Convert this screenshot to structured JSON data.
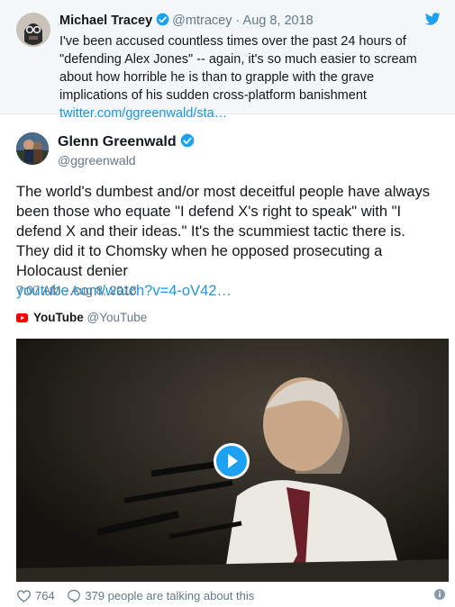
{
  "quoted_tweet": {
    "author_name": "Michael Tracey",
    "handle_date": "@mtracey · Aug 8, 2018",
    "text": "I've been accused countless times over the past 24 hours of \"defending Alex Jones\" -- again, it's so much easier to scream about how horrible he is than to grapple with the grave implications of his sudden cross-platform banishment ",
    "link": "twitter.com/ggreenwald/sta…"
  },
  "tweet": {
    "author_name": "Glenn Greenwald",
    "handle": "@ggreenwald",
    "text": "The world's dumbest and/or most deceitful people have always been those who equate \"I defend X's right to speak\" with \"I defend X and their ideas.\" It's the scummiest tactic there is. They did it to Chomsky when he opposed prosecuting a Holocaust denier",
    "link": "youtube.com/watch?v=4-oV42…",
    "timestamp": "7:07 AM - Aug 8, 2018"
  },
  "card": {
    "source_name": "YouTube",
    "source_handle": "@YouTube"
  },
  "footer": {
    "likes": "764",
    "conversation": "379 people are talking about this"
  },
  "colors": {
    "accent": "#1da1f2",
    "link": "#1b95e0",
    "muted": "#657786",
    "youtube_red": "#ff0000"
  }
}
